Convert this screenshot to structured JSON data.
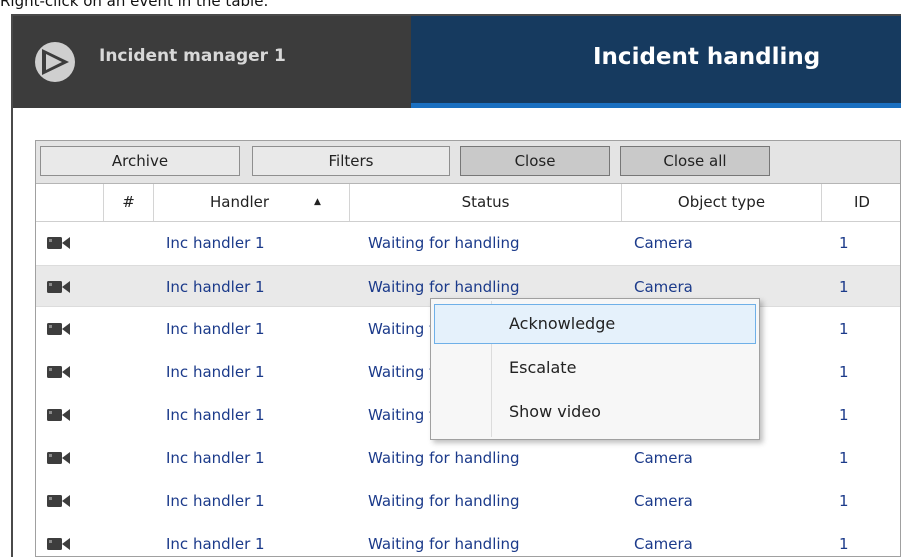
{
  "caption": "Right-click on an event in the table:",
  "app": {
    "title": "Incident manager 1",
    "active_tab": "Incident handling",
    "accent_color": "#1a6fc0",
    "tab_bg": "#163a5f"
  },
  "toolbar": {
    "archive": "Archive",
    "filters": "Filters",
    "close": "Close",
    "close_all": "Close all"
  },
  "table": {
    "columns": [
      "#",
      "Handler",
      "Status",
      "Object type",
      "ID"
    ],
    "sorted_column": "Handler",
    "sort_direction": "ascending",
    "rows": [
      {
        "icon": "camera-icon",
        "handler": "Inc handler 1",
        "status": "Waiting for handling",
        "object_type": "Camera",
        "id": "1"
      },
      {
        "icon": "camera-icon",
        "handler": "Inc handler 1",
        "status": "Waiting for handling",
        "object_type": "Camera",
        "id": "1"
      },
      {
        "icon": "camera-icon",
        "handler": "Inc handler 1",
        "status": "Waiting for handling",
        "object_type": "Camera",
        "id": "1"
      },
      {
        "icon": "camera-icon",
        "handler": "Inc handler 1",
        "status": "Waiting for handling",
        "object_type": "Camera",
        "id": "1"
      },
      {
        "icon": "camera-icon",
        "handler": "Inc handler 1",
        "status": "Waiting for handling",
        "object_type": "Camera",
        "id": "1"
      },
      {
        "icon": "camera-icon",
        "handler": "Inc handler 1",
        "status": "Waiting for handling",
        "object_type": "Camera",
        "id": "1"
      },
      {
        "icon": "camera-icon",
        "handler": "Inc handler 1",
        "status": "Waiting for handling",
        "object_type": "Camera",
        "id": "1"
      },
      {
        "icon": "camera-icon",
        "handler": "Inc handler 1",
        "status": "Waiting for handling",
        "object_type": "Camera",
        "id": "1"
      }
    ],
    "selected_row": 1
  },
  "context_menu": {
    "items": [
      "Acknowledge",
      "Escalate",
      "Show video"
    ],
    "highlighted": "Acknowledge"
  }
}
